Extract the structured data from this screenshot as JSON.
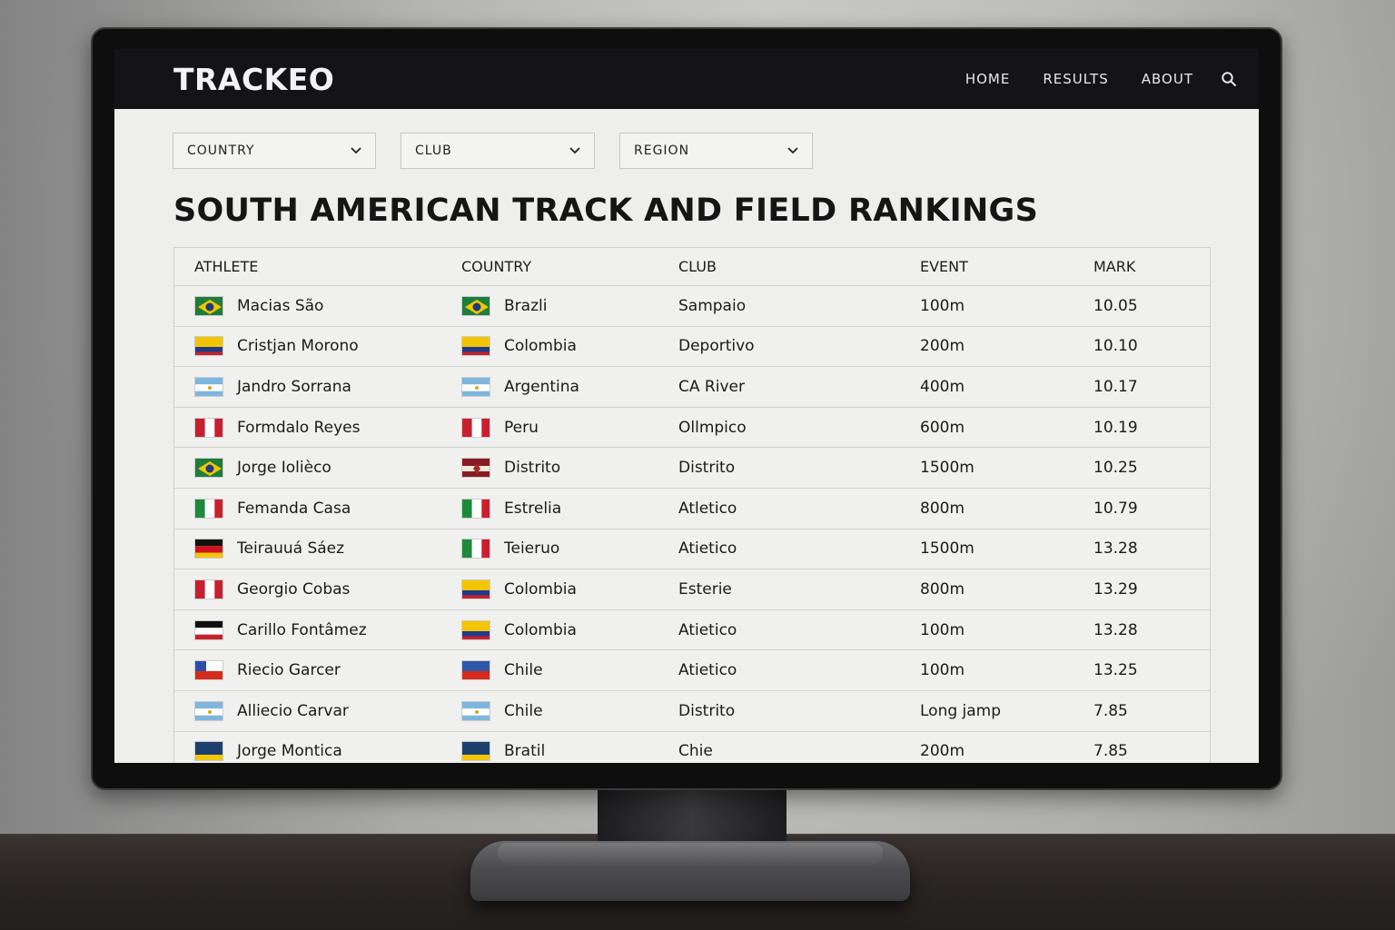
{
  "app": {
    "logo": "TRACKEO",
    "nav": [
      "HOME",
      "RESULTS",
      "ABOUT"
    ]
  },
  "filters": [
    "COUNTRY",
    "CLUB",
    "REGION"
  ],
  "page_title": "SOUTH AMERICAN TRACK AND FIELD RANKINGS",
  "table": {
    "columns": [
      "ATHLETE",
      "COUNTRY",
      "CLUB",
      "EVENT",
      "MARK"
    ],
    "rows": [
      {
        "athlete": "Macias São",
        "athlete_flag": "brazil-flag",
        "country": "Brazli",
        "country_flag": "brazil-flag",
        "club": "Sampaio",
        "event": "100m",
        "mark": "10.05"
      },
      {
        "athlete": "Cristjan Morono",
        "athlete_flag": "colombia-flag",
        "country": "Colombia",
        "country_flag": "colombia-flag",
        "club": "Deportivo",
        "event": "200m",
        "mark": "10.10"
      },
      {
        "athlete": "Jandro Sorrana",
        "athlete_flag": "argentina-flag",
        "country": "Argentina",
        "country_flag": "argentina-flag",
        "club": "CA River",
        "event": "400m",
        "mark": "10.17"
      },
      {
        "athlete": "Formdalo Reyes",
        "athlete_flag": "peru-flag",
        "country": "Peru",
        "country_flag": "peru-flag",
        "club": "Ollmpico",
        "event": "600m",
        "mark": "10.19"
      },
      {
        "athlete": "Jorge Iolièco",
        "athlete_flag": "brazil-flag",
        "country": "Distrito",
        "country_flag": "red-emblem-flag",
        "club": "Distrito",
        "event": "1500m",
        "mark": "10.25"
      },
      {
        "athlete": "Femanda Casa",
        "athlete_flag": "italy-flag",
        "country": "Estrelia",
        "country_flag": "italy-flag",
        "club": "Atletico",
        "event": "800m",
        "mark": "10.79"
      },
      {
        "athlete": "Teirauuá Sáez",
        "athlete_flag": "germany-flag",
        "country": "Teieruo",
        "country_flag": "italy-flag",
        "club": "Atietico",
        "event": "1500m",
        "mark": "13.28"
      },
      {
        "athlete": "Georgio Cobas",
        "athlete_flag": "peru-flag",
        "country": "Colombia",
        "country_flag": "colombia-flag",
        "club": "Esterie",
        "event": "800m",
        "mark": "13.29"
      },
      {
        "athlete": "Carillo Fontâmez",
        "athlete_flag": "black-white-red-flag",
        "country": "Colombia",
        "country_flag": "colombia-flag",
        "club": "Atietico",
        "event": "100m",
        "mark": "13.28"
      },
      {
        "athlete": "Riecio Garcer",
        "athlete_flag": "chile-flag",
        "country": "Chile",
        "country_flag": "blue-red-flag",
        "club": "Atietico",
        "event": "100m",
        "mark": "13.25"
      },
      {
        "athlete": "Alliecio Carvar",
        "athlete_flag": "argentina-flag",
        "country": "Chile",
        "country_flag": "argentina-flag",
        "club": "Distrito",
        "event": "Long jamp",
        "mark": "7.85"
      },
      {
        "athlete": "Jorge Montica",
        "athlete_flag": "blue-yellow-flag",
        "country": "Bratil",
        "country_flag": "blue-yellow-flag",
        "club": "Chie",
        "event": "200m",
        "mark": "7.85"
      }
    ]
  },
  "colors": {
    "topbar": "#141416",
    "screen_bg": "#eeeeed",
    "text": "#1a1a1a"
  }
}
